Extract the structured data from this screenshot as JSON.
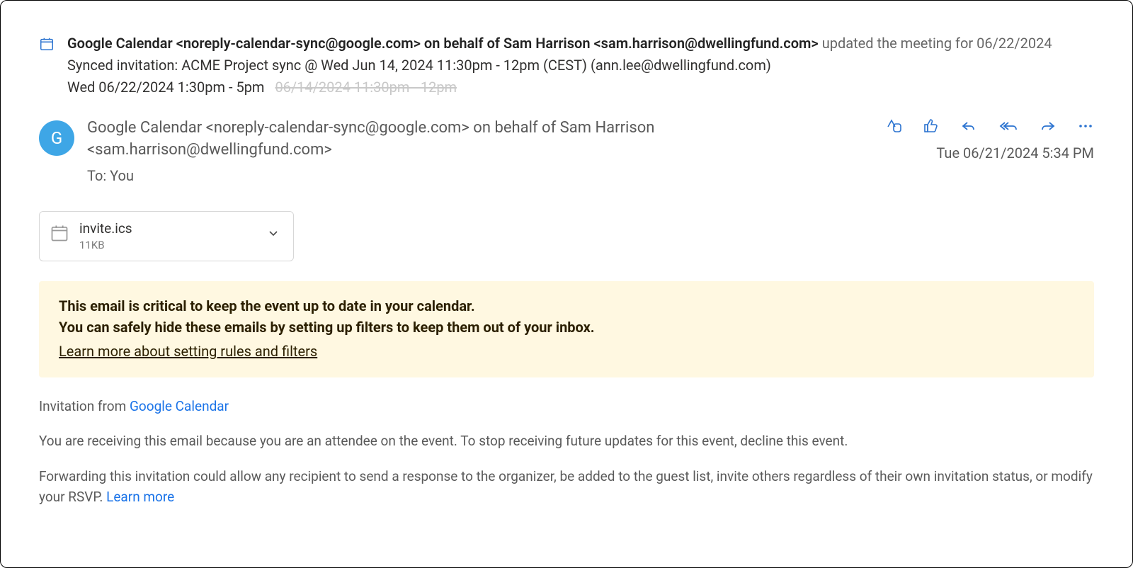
{
  "summary": {
    "sender_bold": "Google Calendar <noreply-calendar-sync@google.com> on behalf of Sam Harrison <sam.harrison@dwellingfund.com>",
    "sender_gray": " updated the meeting for 06/22/2024",
    "subject": "Synced invitation: ACME Project sync @ Wed Jun 14, 2024 11:30pm - 12pm (CEST) (ann.lee@dwellingfund.com)",
    "new_time": "Wed 06/22/2024  1:30pm - 5pm",
    "old_time": "06/14/2024  11:30pm - 12pm"
  },
  "message": {
    "avatar_initial": "G",
    "from": "Google Calendar <noreply-calendar-sync@google.com> on behalf of Sam Harrison <sam.harrison@dwellingfund.com>",
    "to_label": "To: You",
    "timestamp": "Tue 06/21/2024 5:34 PM"
  },
  "attachment": {
    "filename": "invite.ics",
    "size": "11KB"
  },
  "notice": {
    "line1": "This email is critical to keep the event up to date in your calendar.",
    "line2": "You can safely hide these emails by setting up filters to keep them out of your inbox.",
    "learn": "Learn more about setting rules and filters"
  },
  "body": {
    "invitation_prefix": "Invitation from ",
    "invitation_link": "Google Calendar",
    "receiving": "You are receiving this email because you are an attendee on the event. To stop receiving future updates for this event, decline this event.",
    "forwarding": "Forwarding this invitation could allow any recipient to send a response to the organizer, be added to the guest list, invite others regardless of their own invitation status, or modify your RSVP. ",
    "learn_more": "Learn more"
  }
}
